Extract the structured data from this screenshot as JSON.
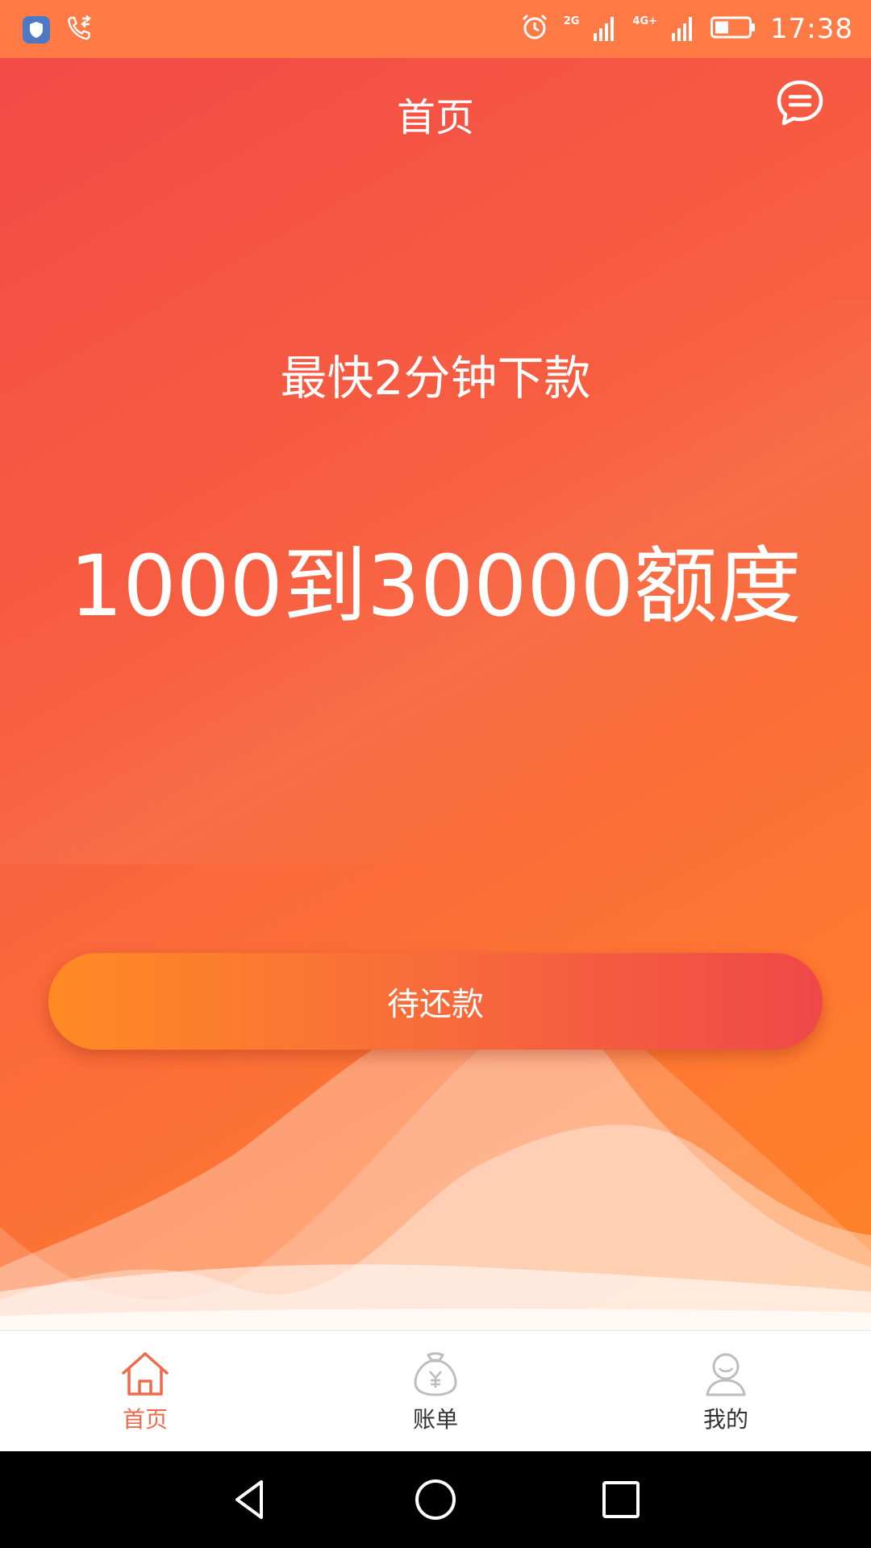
{
  "status_bar": {
    "time": "17:38",
    "network_1": "2G",
    "network_2": "4G+"
  },
  "header": {
    "title": "首页"
  },
  "hero": {
    "subtitle": "最快2分钟下款",
    "amount": "1000到30000额度"
  },
  "actions": {
    "repay_label": "待还款"
  },
  "tabs": [
    {
      "label": "首页",
      "icon": "home-icon",
      "active": true
    },
    {
      "label": "账单",
      "icon": "money-bag-icon",
      "active": false
    },
    {
      "label": "我的",
      "icon": "user-icon",
      "active": false
    }
  ],
  "colors": {
    "accent": "#f06a4a",
    "gradient_start": "#f34a48",
    "gradient_end": "#ff8328"
  }
}
